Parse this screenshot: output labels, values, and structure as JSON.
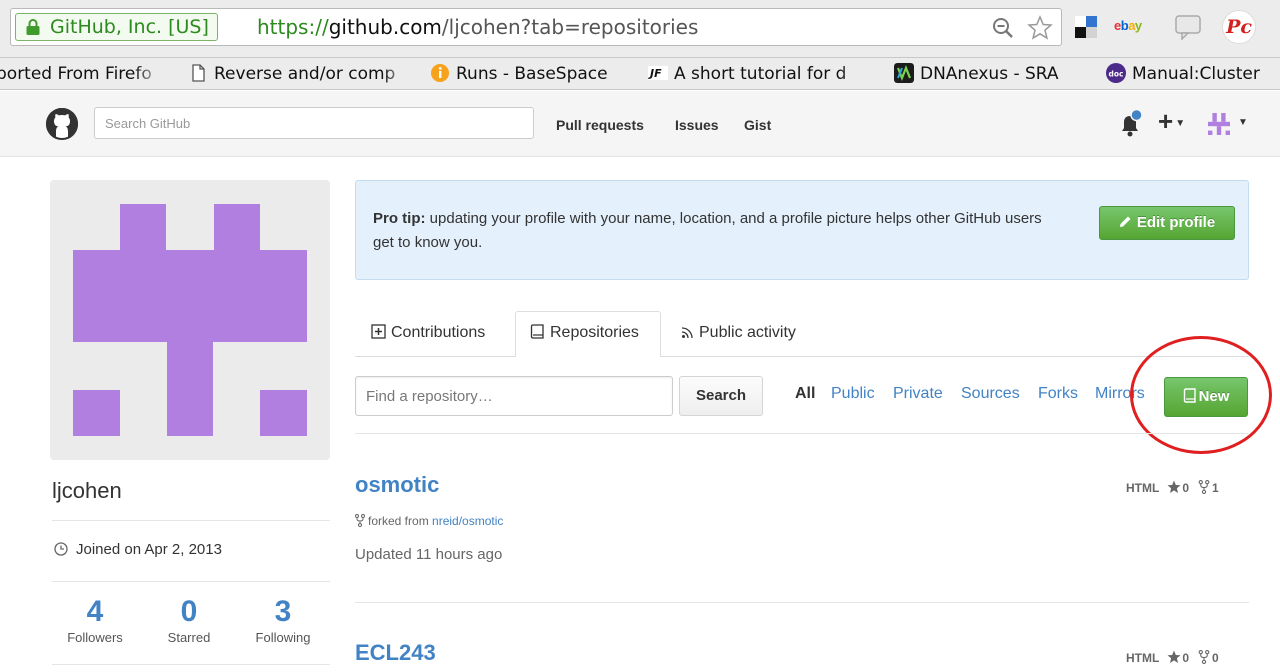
{
  "browser": {
    "ev_label": "GitHub, Inc. [US]",
    "url_scheme": "https://",
    "url_host": "github.com",
    "url_path": "/ljcohen?tab=repositories",
    "ebay_label": "ebay",
    "pc_label": "Pc"
  },
  "bookmarks": [
    {
      "label": "ported From Firefo",
      "icon": "none"
    },
    {
      "label": "Reverse and/or comp",
      "icon": "document-icon"
    },
    {
      "label": "Runs - BaseSpace",
      "icon": "info-icon"
    },
    {
      "label": "A short tutorial for d",
      "icon": "tutorial-icon"
    },
    {
      "label": "DNAnexus - SRA",
      "icon": "dnanexus-icon"
    },
    {
      "label": "Manual:Cluster",
      "icon": "doc-icon"
    }
  ],
  "header": {
    "search_placeholder": "Search GitHub",
    "nav": [
      "Pull requests",
      "Issues",
      "Gist"
    ],
    "plus_label": "+"
  },
  "profile": {
    "username": "ljcohen",
    "joined": "Joined on Apr 2, 2013",
    "stats": [
      {
        "value": "4",
        "label": "Followers"
      },
      {
        "value": "0",
        "label": "Starred"
      },
      {
        "value": "3",
        "label": "Following"
      }
    ],
    "avatar_color": "#b07fe0"
  },
  "protip": {
    "bold": "Pro tip:",
    "text": " updating your profile with your name, location, and a profile picture helps other GitHub users get to know you.",
    "button": "Edit profile"
  },
  "tabs": [
    "Contributions",
    "Repositories",
    "Public activity"
  ],
  "repo_filter": {
    "placeholder": "Find a repository…",
    "search_button": "Search",
    "filters": [
      "All",
      "Public",
      "Private",
      "Sources",
      "Forks",
      "Mirrors"
    ],
    "new_button": "New"
  },
  "repos": [
    {
      "name": "osmotic",
      "forked_prefix": "forked from ",
      "forked_from": "nreid/osmotic",
      "updated": "Updated 11 hours ago",
      "language": "HTML",
      "stars": "0",
      "forks": "1"
    },
    {
      "name": "ECL243",
      "language": "HTML",
      "stars": "0",
      "forks": "0"
    }
  ],
  "colors": {
    "link": "#4183c4",
    "green": "#55a532",
    "protip_bg": "#e4f0fc",
    "annotation_red": "#e02020"
  }
}
